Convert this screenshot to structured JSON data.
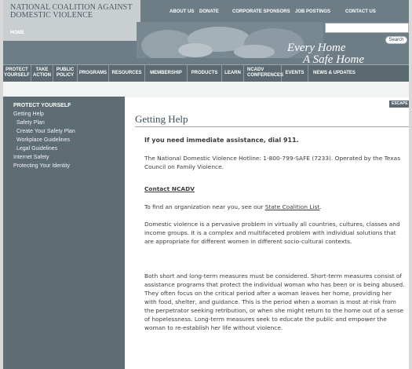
{
  "header": {
    "org_name": "National Coalition Against Domestic Violence",
    "home_link": "HOME",
    "tagline_line1": "Every Home",
    "tagline_line2": "A Safe Home",
    "search_placeholder": "",
    "search_button": "Search"
  },
  "top_nav": [
    "ABOUT US",
    "DONATE",
    "CORPORATE SPONSORS",
    "JOB POSTINGS",
    "CONTACT US"
  ],
  "main_nav": [
    "PROTECT YOURSELF",
    "TAKE ACTION",
    "PUBLIC POLICY",
    "PROGRAMS",
    "RESOURCES",
    "MEMBERSHIP",
    "PRODUCTS",
    "LEARN",
    "NCADV CONFERENCES",
    "EVENTS",
    "NEWS & UPDATES"
  ],
  "escape_label": "ESCAPE",
  "sidebar": {
    "title": "PROTECT YOURSELF",
    "items": [
      "Getting Help",
      "Safety Plan",
      "Create Your Safety Plan",
      "Workplace Guidelines",
      "Legal Guidelines",
      "Internet Safety",
      "Protecting Your Identity"
    ]
  },
  "content": {
    "title": "Getting Help",
    "urgent": "If you need immediate assistance, dial 911.",
    "hotline": "The National Domestic Violence Hotline: 1-800-799-SAFE (7233). Operated by the Texas Council on Family Violence.",
    "contact_heading": "Contact NCADV",
    "find_org_prefix": "To find an organization near you, see our ",
    "find_org_link": "State Coalition List",
    "find_org_suffix": ".",
    "para1": "Domestic violence is a pervasive problem in virtually all countries, cultures, classes and income groups. It is a complex and multifaceted problem with individual solutions that are appropriate for different women in different socio-cultural contexts.",
    "para2": "Both short and long-term measures must be considered. Short-term measures consist of assistance programs that protect the individual woman who has been or is being abused. They often focus on the critical period after a woman leaves her home, providing her with food, shelter, and guidance. This is the period when a woman is most at-risk from the perpetrator seeking retribution, or when she might return to the home out of a sense of hopelessness. Long-term measures seek to educate the public and empower the woman to re-establish her life without violence."
  }
}
